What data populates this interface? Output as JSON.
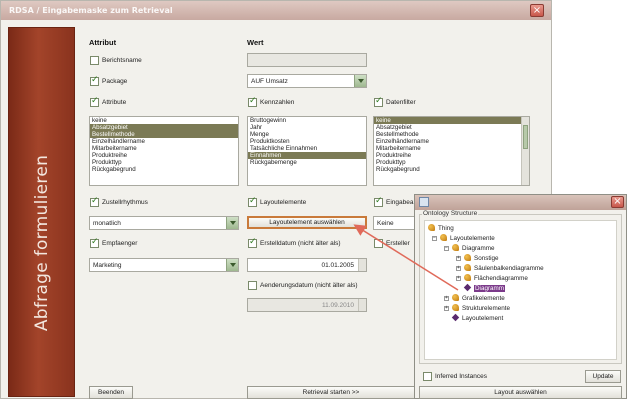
{
  "window": {
    "title": "RDSA / Eingabemaske zum Retrieval"
  },
  "side": {
    "label": "Abfrage formulieren"
  },
  "headers": {
    "attribut": "Attribut",
    "wert": "Wert"
  },
  "rows": {
    "berichtsname": {
      "label": "Berichtsname",
      "checked": false,
      "value": ""
    },
    "package": {
      "label": "Package",
      "checked": true,
      "value": "AUF Umsatz"
    },
    "attribute": {
      "label": "Attribute",
      "checked": true
    },
    "kennzahlen": {
      "label": "Kennzahlen",
      "checked": true
    },
    "datenfilter": {
      "label": "Datenfilter",
      "checked": true
    },
    "zustellrhythmus": {
      "label": "Zustellrhythmus",
      "checked": true,
      "value": "monatlich"
    },
    "layoutelemente": {
      "label": "Layoutelemente",
      "checked": true,
      "button": "Layoutelement auswählen"
    },
    "eingabe": {
      "label": "Eingabea",
      "checked": true,
      "value": "Keine"
    },
    "empfaenger": {
      "label": "Empfaenger",
      "checked": true,
      "value": "Marketing"
    },
    "erstelldatum": {
      "label": "Erstelldatum (nicht älter als)",
      "checked": true,
      "value": "01.01.2005"
    },
    "ersteller": {
      "label": "Ersteller",
      "checked": false
    },
    "aenderungsdatum": {
      "label": "Aenderungsdatum (nicht älter als)",
      "checked": false,
      "value": "11.09.2010"
    }
  },
  "lists": {
    "attribute": [
      "keine",
      "Absatzgebiet",
      "Bestellmethode",
      "Einzelhändlername",
      "Mitarbeitername",
      "Produktreihe",
      "Produkttyp",
      "Rückgabegrund"
    ],
    "attribute_selected": [
      1,
      2
    ],
    "kennzahlen": [
      "Bruttogewinn",
      "Jahr",
      "Menge",
      "Produktkosten",
      "Tatsächliche Einnahmen",
      "Einnahmen",
      "Rückgabemenge"
    ],
    "kennzahlen_selected": [
      5
    ],
    "datenfilter": [
      "keine",
      "Absatzgebiet",
      "Bestellmethode",
      "Einzelhändlername",
      "Mitarbeitername",
      "Produktreihe",
      "Produkttyp",
      "Rückgabegrund"
    ],
    "datenfilter_selected": [
      0
    ]
  },
  "buttons": {
    "beenden": "Beenden",
    "retrieval": "Retrieval starten >>"
  },
  "dialog": {
    "legend": "Ontology Structure",
    "tree": {
      "thing": "Thing",
      "layoutelemente": "Layoutelemente",
      "diagramme": "Diagramme",
      "sonstige": "Sonstige",
      "saeulen": "Säulen­balken­diagramme",
      "flaechen": "Flächendiagramme",
      "diagramm": "Diagramm",
      "grafikelemente": "Grafikelemente",
      "struktur": "Strukturelemente",
      "layoutelement": "Layoutelement"
    },
    "inferred_label": "Inferred Instances",
    "update_label": "Update",
    "choose_label": "Layout auswählen"
  },
  "colors": {
    "accent": "#a3442a",
    "selection": "#7b7a55",
    "tree_selection": "#7b3a8a",
    "arrow": "#e06a5a"
  }
}
